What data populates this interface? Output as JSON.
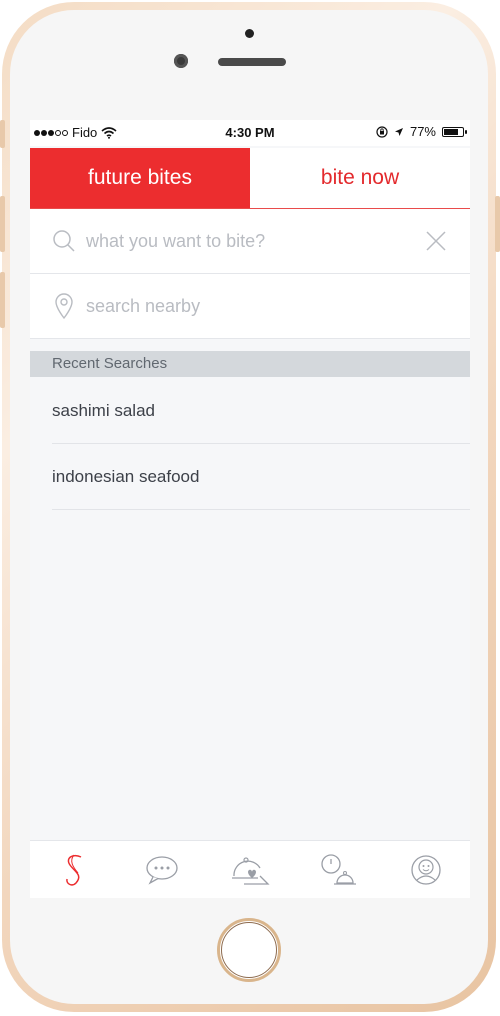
{
  "status_bar": {
    "carrier": "Fido",
    "time": "4:30 PM",
    "battery": "77%",
    "battery_level": 0.77,
    "signal_bars": 3,
    "icons": [
      "wifi-icon",
      "rotation-lock-icon",
      "location-arrow-icon",
      "battery-icon"
    ]
  },
  "tabs": [
    {
      "label": "future bites",
      "active": true
    },
    {
      "label": "bite now",
      "active": false
    }
  ],
  "search": {
    "query_placeholder": "what you want to bite?",
    "location_placeholder": "search nearby"
  },
  "recent": {
    "header": "Recent Searches",
    "items": [
      "sashimi salad",
      "indonesian seafood"
    ]
  },
  "tab_bar": {
    "items": [
      "s-logo-icon",
      "chat-bubble-icon",
      "cloche-heart-icon",
      "clock-cloche-icon",
      "profile-face-icon"
    ]
  },
  "colors": {
    "accent": "#ec2d2f",
    "section_header_bg": "#d4d8dc",
    "screen_bg": "#f6f7f9"
  }
}
